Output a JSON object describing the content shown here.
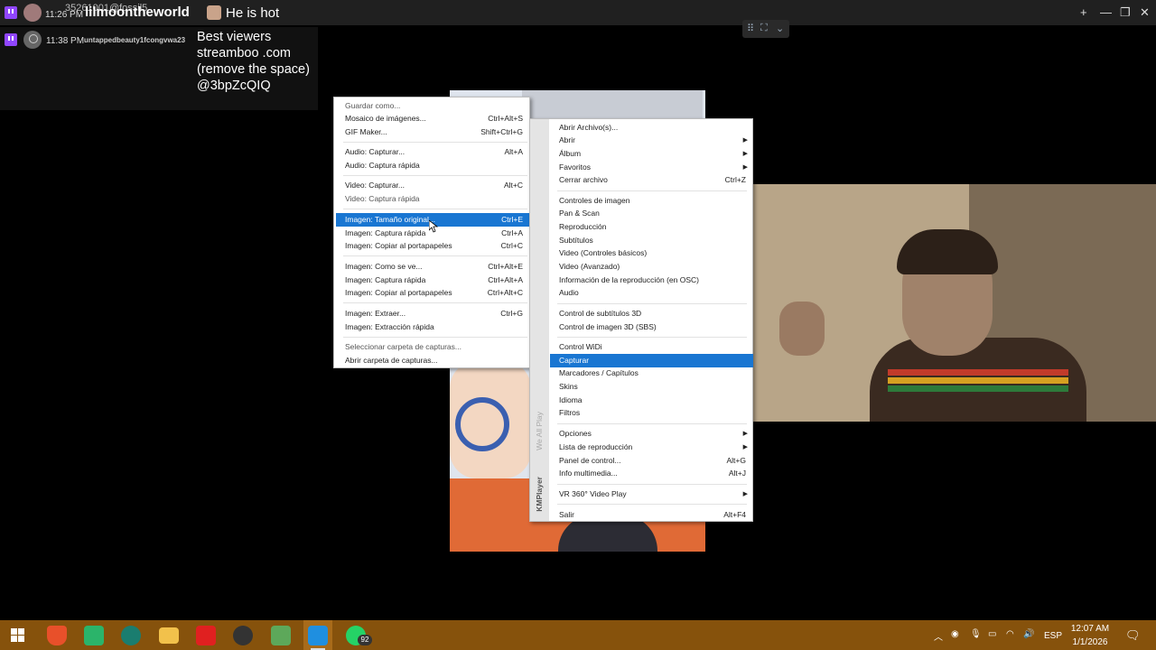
{
  "topbar": {
    "time": "11:26 PM",
    "id_text": "35261001@fossil5",
    "username": "lilmoontheworld",
    "message": "He is hot",
    "window_controls": [
      "+",
      "—",
      "❐",
      "✕"
    ]
  },
  "chat": {
    "time": "11:38 PM",
    "username": "untappedbeauty1fcongvwa23",
    "message": "Best viewers streamboo .com (remove the space) @3bpZcQIQ"
  },
  "capture_menu": {
    "items": [
      {
        "label": "Guardar como...",
        "shortcut": "",
        "disabled": true
      },
      {
        "label": "Mosaico de imágenes...",
        "shortcut": "Ctrl+Alt+S"
      },
      {
        "label": "GIF Maker...",
        "shortcut": "Shift+Ctrl+G"
      },
      {
        "label": "Audio: Capturar...",
        "shortcut": "Alt+A"
      },
      {
        "label": "Audio: Captura rápida",
        "shortcut": ""
      },
      {
        "label": "Video: Capturar...",
        "shortcut": "Alt+C"
      },
      {
        "label": "Video: Captura rápida",
        "shortcut": "",
        "disabled": true
      },
      {
        "label": "Imagen: Tamaño original...",
        "shortcut": "Ctrl+E",
        "selected": true
      },
      {
        "label": "Imagen: Captura rápida",
        "shortcut": "Ctrl+A"
      },
      {
        "label": "Imagen: Copiar al portapapeles",
        "shortcut": "Ctrl+C"
      },
      {
        "label": "Imagen: Como se ve...",
        "shortcut": "Ctrl+Alt+E"
      },
      {
        "label": "Imagen: Captura rápida",
        "shortcut": "Ctrl+Alt+A"
      },
      {
        "label": "Imagen: Copiar al portapapeles",
        "shortcut": "Ctrl+Alt+C"
      },
      {
        "label": "Imagen: Extraer...",
        "shortcut": "Ctrl+G"
      },
      {
        "label": "Imagen: Extracción rápida",
        "shortcut": ""
      },
      {
        "label": "Seleccionar carpeta de capturas...",
        "shortcut": "",
        "disabled": true
      },
      {
        "label": "Abrir carpeta de capturas...",
        "shortcut": ""
      }
    ]
  },
  "main_menu": {
    "items": [
      {
        "label": "Abrir Archivo(s)...",
        "shortcut": ""
      },
      {
        "label": "Abrir",
        "shortcut": "",
        "submenu": true
      },
      {
        "label": "Álbum",
        "shortcut": "",
        "submenu": true
      },
      {
        "label": "Favoritos",
        "shortcut": "",
        "submenu": true
      },
      {
        "label": "Cerrar archivo",
        "shortcut": "Ctrl+Z"
      },
      {
        "label": "Controles de imagen",
        "shortcut": ""
      },
      {
        "label": "Pan & Scan",
        "shortcut": ""
      },
      {
        "label": "Reproducción",
        "shortcut": ""
      },
      {
        "label": "Subtítulos",
        "shortcut": ""
      },
      {
        "label": "Video (Controles básicos)",
        "shortcut": ""
      },
      {
        "label": "Video (Avanzado)",
        "shortcut": ""
      },
      {
        "label": "Información de la reproducción (en OSC)",
        "shortcut": ""
      },
      {
        "label": "Audio",
        "shortcut": ""
      },
      {
        "label": "Control de subtítulos 3D",
        "shortcut": ""
      },
      {
        "label": "Control de imagen 3D (SBS)",
        "shortcut": ""
      },
      {
        "label": "Control WiDi",
        "shortcut": ""
      },
      {
        "label": "Capturar",
        "shortcut": "",
        "selected": true
      },
      {
        "label": "Marcadores / Capítulos",
        "shortcut": ""
      },
      {
        "label": "Skins",
        "shortcut": ""
      },
      {
        "label": "Idioma",
        "shortcut": ""
      },
      {
        "label": "Filtros",
        "shortcut": ""
      },
      {
        "label": "Opciones",
        "shortcut": "",
        "submenu": true
      },
      {
        "label": "Lista de reproducción",
        "shortcut": "",
        "submenu": true
      },
      {
        "label": "Panel de control...",
        "shortcut": "Alt+G"
      },
      {
        "label": "Info multimedia...",
        "shortcut": "Alt+J"
      },
      {
        "label": "VR 360° Video Play",
        "shortcut": "",
        "submenu": true
      },
      {
        "label": "Salir",
        "shortcut": "Alt+F4"
      }
    ],
    "brand": "KMPlayer",
    "brand_sub": "We All Play"
  },
  "taskbar": {
    "badge": "92",
    "language": "ESP",
    "time": "12:07 AM",
    "date": "1/1/2026"
  },
  "colors": {
    "selection": "#1976d2",
    "taskbar": "#86520c",
    "twitch": "#9146ff"
  }
}
